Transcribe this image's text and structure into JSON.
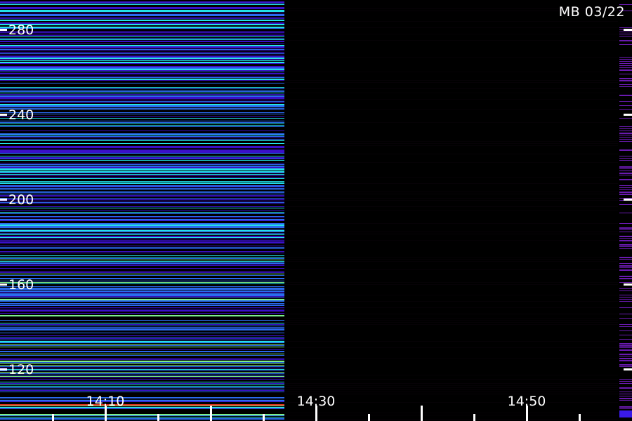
{
  "station_label": "MB 03/22",
  "chart_data": {
    "type": "heatmap",
    "title": "MB 03/22",
    "xlabel": "",
    "ylabel": "",
    "x_axis": {
      "unit": "time",
      "tick_labels": [
        "14:10",
        "14:30",
        "14:50"
      ],
      "minor_tick_interval_minutes": 5,
      "range": [
        "14:05",
        "14:36"
      ]
    },
    "y_axis": {
      "tick_labels": [
        280,
        240,
        200,
        160,
        120
      ],
      "range": [
        100,
        290
      ]
    },
    "data_end_time": "14:27",
    "colors": {
      "background": "#000000",
      "dead_band": "#080208",
      "low": "#3a10c8",
      "mid": "#2a6af0",
      "high": "#22e0e8",
      "peak": "#7cf08a",
      "hot": "#e03020",
      "right_bar": "#6a1ab0",
      "right_bar_bottom": "#3a1ae8",
      "tick": "#ffffff"
    },
    "grid": false,
    "legend": "none"
  }
}
